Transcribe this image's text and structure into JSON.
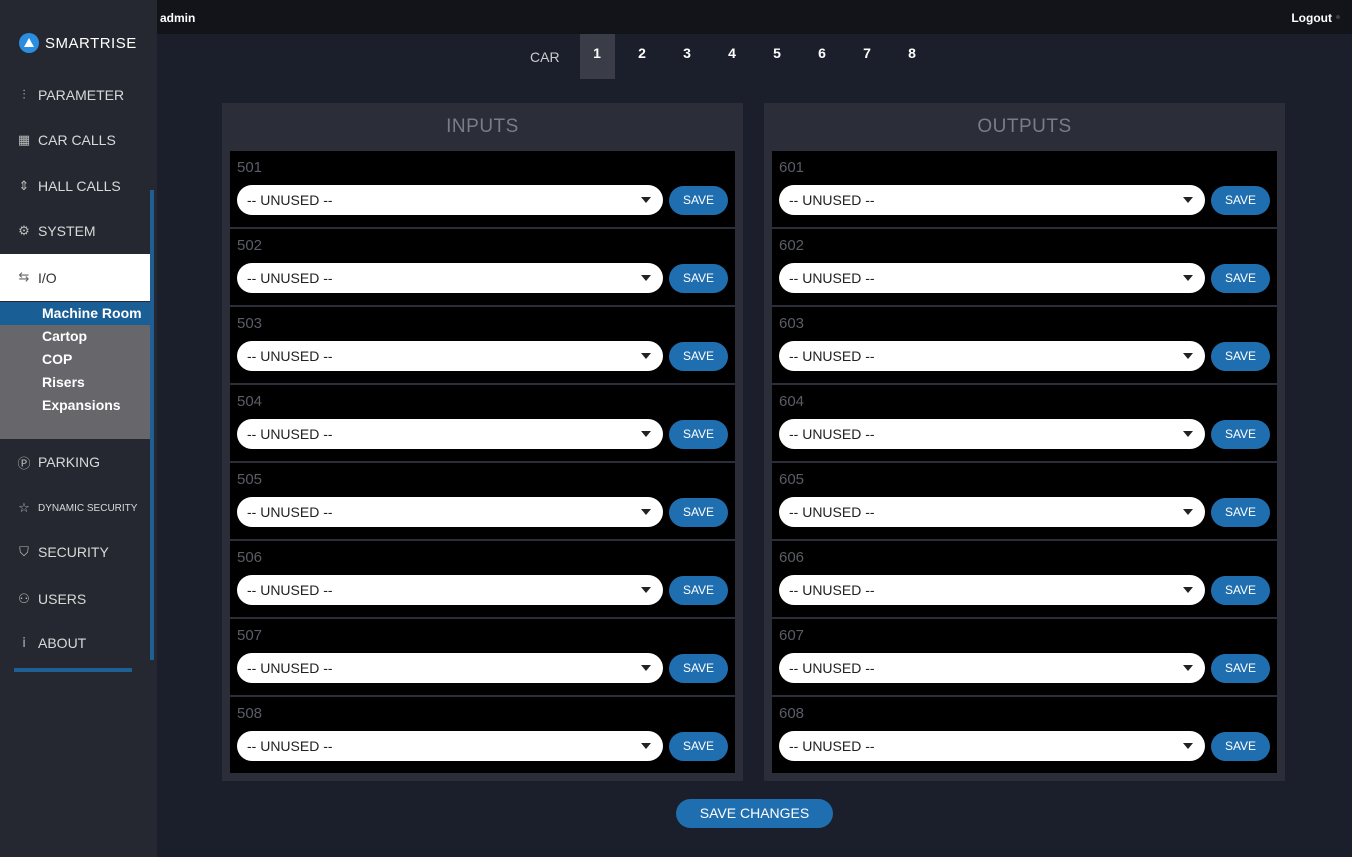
{
  "topbar": {
    "user": "admin",
    "logout": "Logout"
  },
  "logo": {
    "text": "SMARTRISE"
  },
  "sidebar": {
    "items": [
      {
        "label": "PARAMETER",
        "icon": "sliders-icon"
      },
      {
        "label": "CAR CALLS",
        "icon": "keypad-icon"
      },
      {
        "label": "HALL CALLS",
        "icon": "up-down-chevron-icon"
      },
      {
        "label": "SYSTEM",
        "icon": "gear-icon"
      },
      {
        "label": "I/O",
        "icon": "swap-arrows-icon"
      },
      {
        "label": "PARKING",
        "icon": "parking-icon"
      },
      {
        "label": "DYNAMIC SECURITY",
        "icon": "star-icon"
      },
      {
        "label": "SECURITY",
        "icon": "shield-icon"
      },
      {
        "label": "USERS",
        "icon": "users-icon"
      },
      {
        "label": "ABOUT",
        "icon": "info-icon"
      }
    ],
    "io_sub": [
      "Machine Room",
      "Cartop",
      "COP",
      "Risers",
      "Expansions"
    ]
  },
  "cars": {
    "label": "CAR",
    "tabs": [
      "1",
      "2",
      "3",
      "4",
      "5",
      "6",
      "7",
      "8"
    ],
    "active": "1"
  },
  "inputs": {
    "title": "INPUTS",
    "rows": [
      {
        "num": "501",
        "value": "-- UNUSED --",
        "save": "SAVE"
      },
      {
        "num": "502",
        "value": "-- UNUSED --",
        "save": "SAVE"
      },
      {
        "num": "503",
        "value": "-- UNUSED --",
        "save": "SAVE"
      },
      {
        "num": "504",
        "value": "-- UNUSED --",
        "save": "SAVE"
      },
      {
        "num": "505",
        "value": "-- UNUSED --",
        "save": "SAVE"
      },
      {
        "num": "506",
        "value": "-- UNUSED --",
        "save": "SAVE"
      },
      {
        "num": "507",
        "value": "-- UNUSED --",
        "save": "SAVE"
      },
      {
        "num": "508",
        "value": "-- UNUSED --",
        "save": "SAVE"
      }
    ]
  },
  "outputs": {
    "title": "OUTPUTS",
    "rows": [
      {
        "num": "601",
        "value": "-- UNUSED --",
        "save": "SAVE"
      },
      {
        "num": "602",
        "value": "-- UNUSED --",
        "save": "SAVE"
      },
      {
        "num": "603",
        "value": "-- UNUSED --",
        "save": "SAVE"
      },
      {
        "num": "604",
        "value": "-- UNUSED --",
        "save": "SAVE"
      },
      {
        "num": "605",
        "value": "-- UNUSED --",
        "save": "SAVE"
      },
      {
        "num": "606",
        "value": "-- UNUSED --",
        "save": "SAVE"
      },
      {
        "num": "607",
        "value": "-- UNUSED --",
        "save": "SAVE"
      },
      {
        "num": "608",
        "value": "-- UNUSED --",
        "save": "SAVE"
      }
    ]
  },
  "save_changes": "SAVE CHANGES",
  "colors": {
    "accent": "#1f6fb0",
    "active_sub": "#1a5e96",
    "background": "#1b1e2b",
    "panel": "#2b2e38"
  }
}
